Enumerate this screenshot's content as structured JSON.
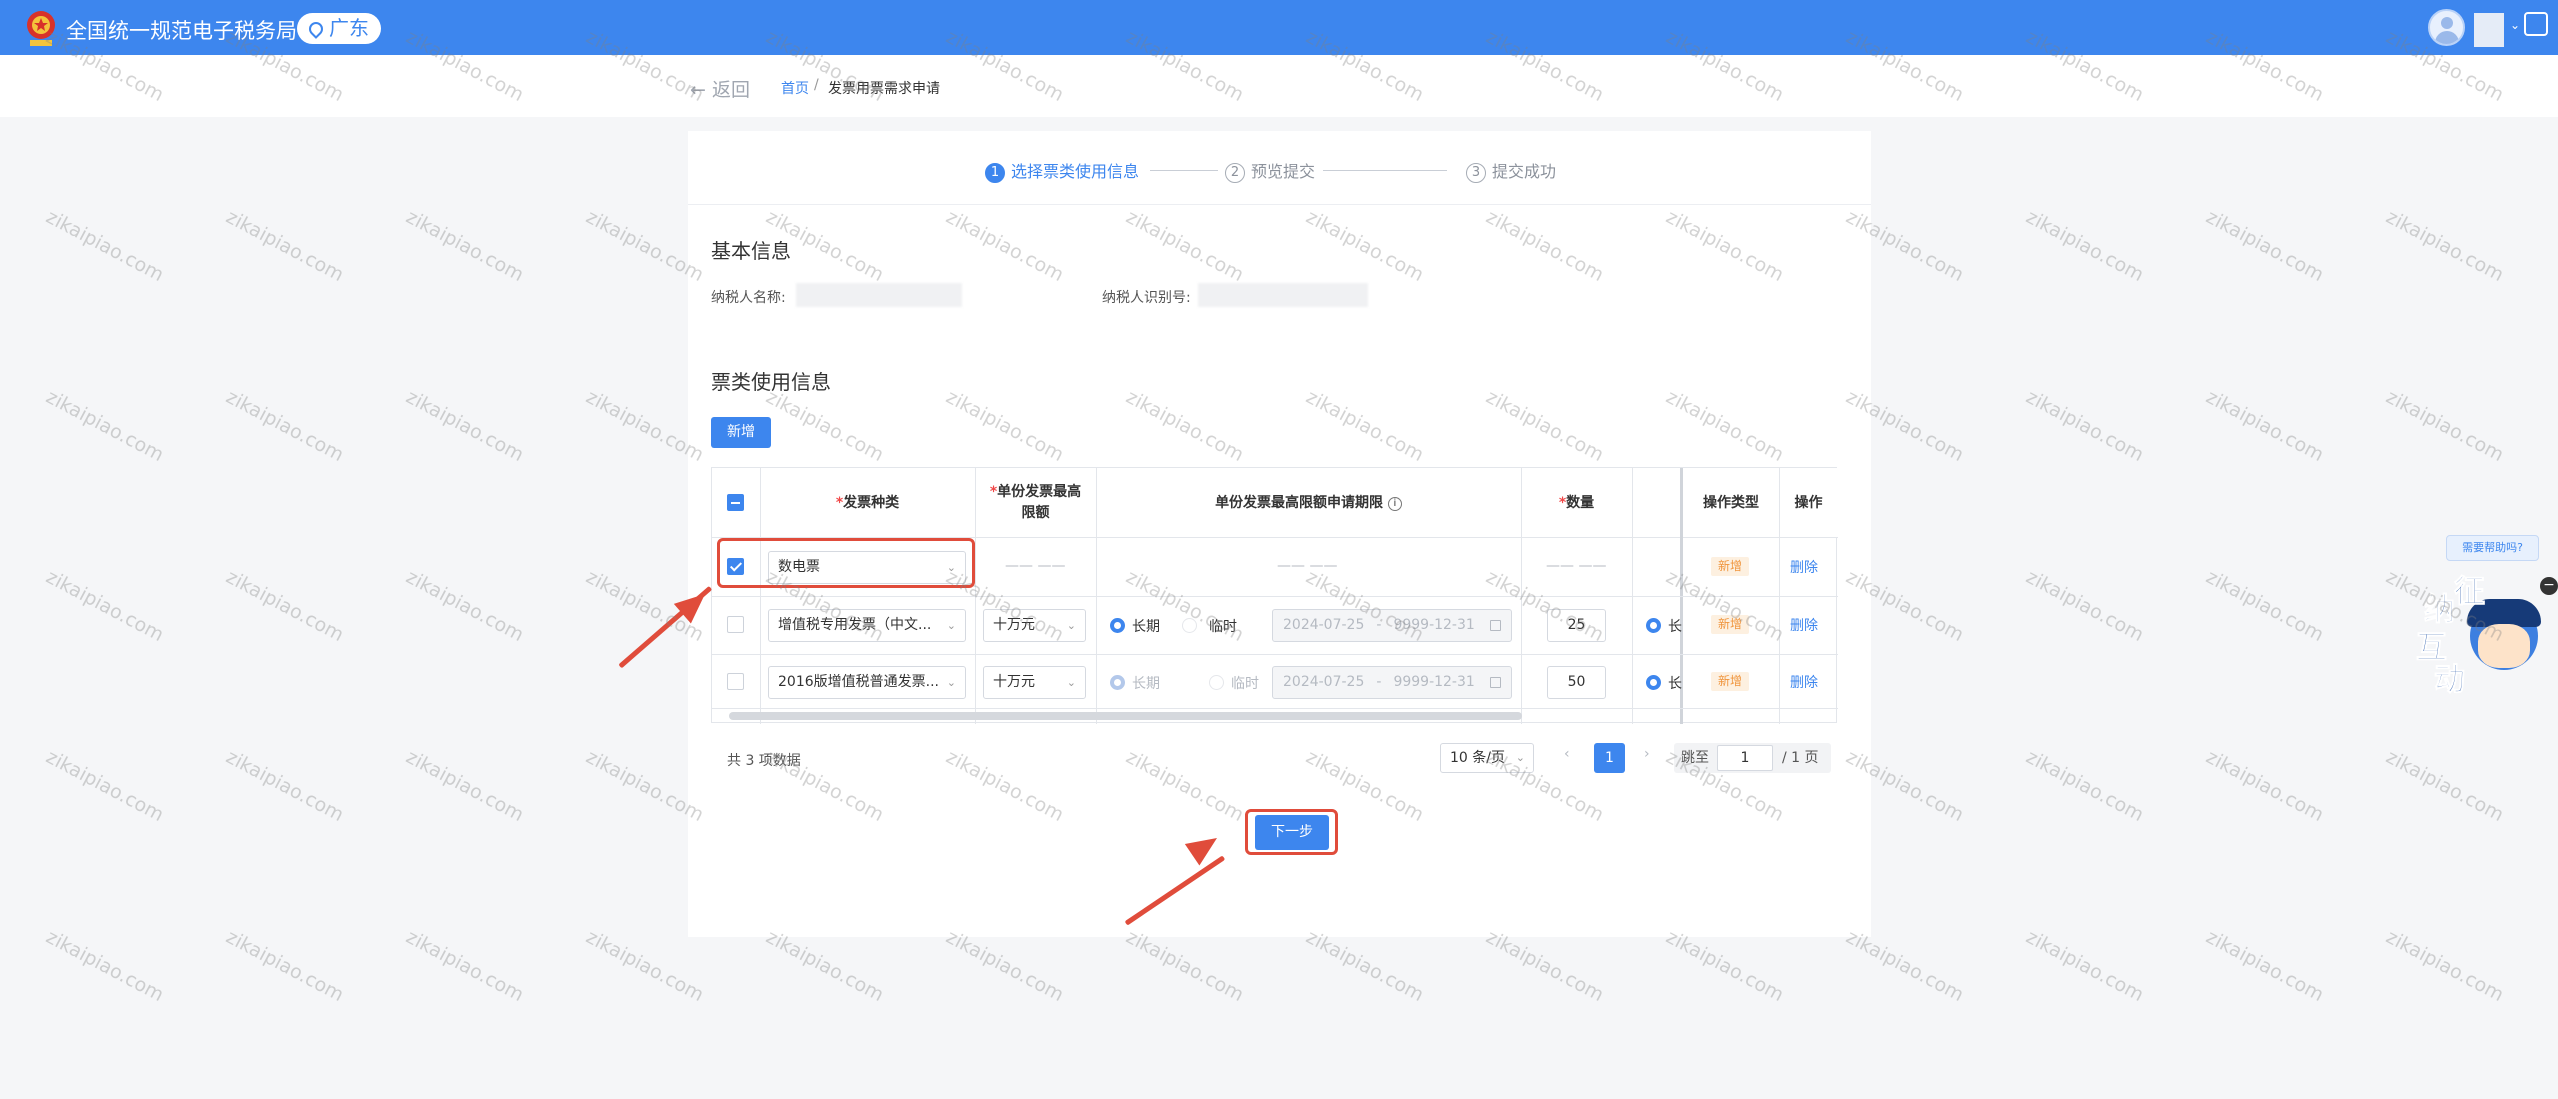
{
  "header": {
    "app_title": "全国统一规范电子税务局",
    "region": "广东",
    "icons": [
      "national-emblem-icon",
      "location-pin-icon",
      "user-avatar-icon",
      "chevron-down-icon",
      "scan-icon"
    ]
  },
  "breadcrumb": {
    "back_label": "返回",
    "home_label": "首页",
    "separator": "/",
    "current_label": "发票用票需求申请"
  },
  "steps": [
    {
      "number": "1",
      "label": "选择票类使用信息",
      "state": "active"
    },
    {
      "number": "2",
      "label": "预览提交",
      "state": "pending"
    },
    {
      "number": "3",
      "label": "提交成功",
      "state": "pending"
    }
  ],
  "basic_info": {
    "title": "基本信息",
    "taxpayer_name_label": "纳税人名称:",
    "taxpayer_id_label": "纳税人识别号:"
  },
  "usage_info": {
    "title": "票类使用信息",
    "add_button": "新增"
  },
  "table": {
    "columns": {
      "invoice_type": "发票种类",
      "max_amount": "单份发票最高限额",
      "period": "单份发票最高限额申请期限",
      "quantity": "数量",
      "op_type": "操作类型",
      "action": "操作"
    },
    "required_mark": "*",
    "rows": [
      {
        "checked": true,
        "invoice_type": "数电票",
        "max_amount": "—— ——",
        "period": "—— ——",
        "quantity": "—— ——",
        "period_type": "",
        "op_type": "新增",
        "action": "删除",
        "highlighted": true
      },
      {
        "checked": false,
        "invoice_type": "增值税专用发票（中文...",
        "max_amount": "十万元",
        "period_long": "长期",
        "period_temp": "临时",
        "period_selected": "长期",
        "date_start": "2024-07-25",
        "date_sep": "-",
        "date_end": "9999-12-31",
        "quantity": "25",
        "period_type": "长",
        "op_type": "新增",
        "action": "删除",
        "disabled": false
      },
      {
        "checked": false,
        "invoice_type": "2016版增值税普通发票...",
        "max_amount": "十万元",
        "period_long": "长期",
        "period_temp": "临时",
        "period_selected": "长期",
        "date_start": "2024-07-25",
        "date_sep": "-",
        "date_end": "9999-12-31",
        "quantity": "50",
        "period_type": "长",
        "op_type": "新增",
        "action": "删除",
        "disabled": true
      }
    ]
  },
  "pagination": {
    "total_text": "共 3 项数据",
    "page_size": "10 条/页",
    "prev": "‹",
    "next": "›",
    "current_page": "1",
    "jump_label": "跳至",
    "jump_value": "1",
    "total_pages_text": "/ 1 页"
  },
  "next_button": "下一步",
  "assistant": {
    "bubble": "需要帮助吗?",
    "chars": [
      "征",
      "纳",
      "互",
      "动"
    ],
    "close": "−"
  },
  "watermark_text": "zikaipiao.com",
  "colors": {
    "primary": "#3d86ee",
    "header_bg": "#3d86ee",
    "annotation_red": "#e04c3b",
    "tag_orange": "#f0953d",
    "required_red": "#f04848"
  }
}
